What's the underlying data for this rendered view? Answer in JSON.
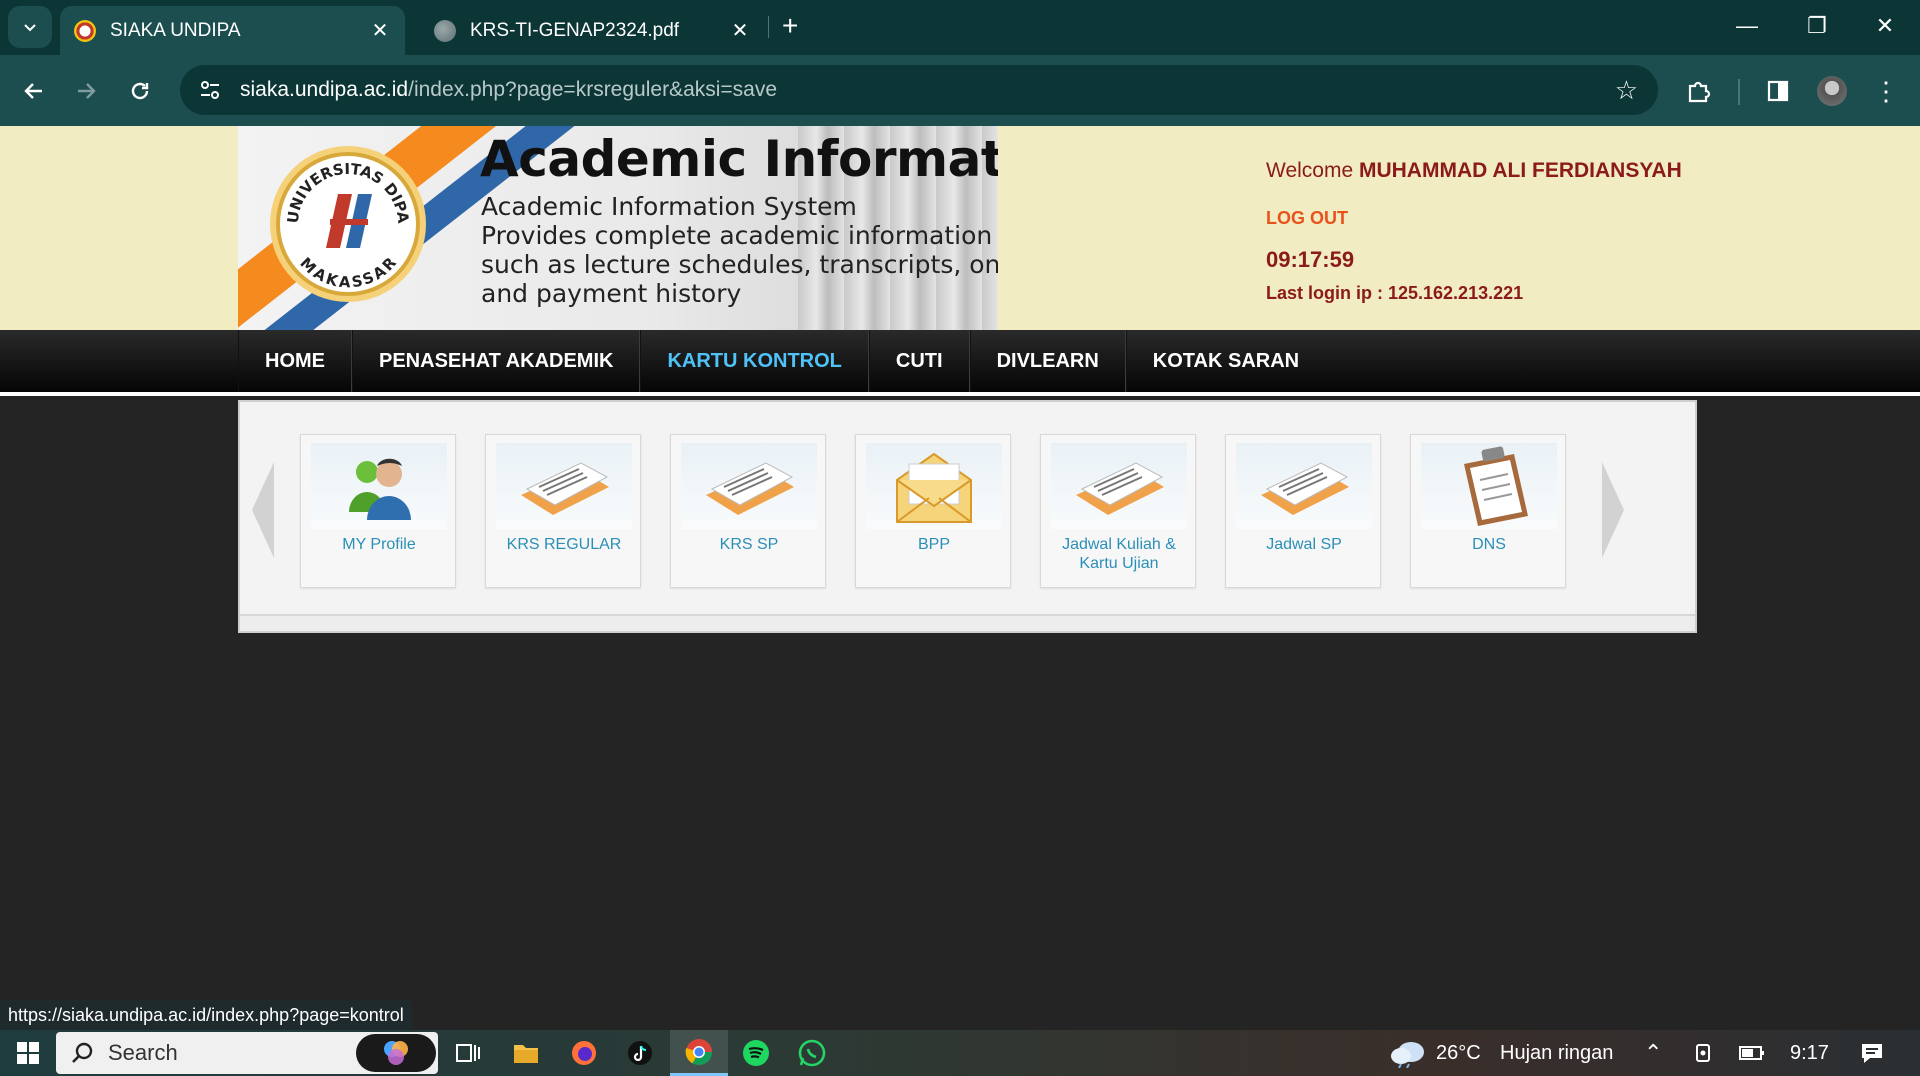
{
  "browser": {
    "tabs": [
      {
        "title": "SIAKA UNDIPA",
        "active": true
      },
      {
        "title": "KRS-TI-GENAP2324.pdf",
        "active": false
      }
    ],
    "url_domain": "siaka.undipa.ac.id",
    "url_path": "/index.php?page=krsreguler&aksi=save",
    "status_url": "https://siaka.undipa.ac.id/index.php?page=kontrol"
  },
  "header": {
    "title": "Academic Information System",
    "desc": [
      "Academic Information System",
      "Provides complete academic information",
      "such as lecture schedules, transcripts, online KRS,",
      "and payment history"
    ],
    "logo_top": "UNIVERSITAS DIPA",
    "logo_bottom": "MAKASSAR",
    "welcome_label": "Welcome",
    "user_name": "MUHAMMAD ALI FERDIANSYAH",
    "logout": "LOG OUT",
    "clock": "09:17:59",
    "last_login": "Last login ip : 125.162.213.221"
  },
  "menu": [
    {
      "label": "HOME",
      "selected": false
    },
    {
      "label": "PENASEHAT AKADEMIK",
      "selected": false
    },
    {
      "label": "KARTU KONTROL",
      "selected": true
    },
    {
      "label": "CUTI",
      "selected": false
    },
    {
      "label": "DIVLEARN",
      "selected": false
    },
    {
      "label": "KOTAK SARAN",
      "selected": false
    }
  ],
  "tiles": [
    {
      "label": "MY Profile",
      "icon": "users-icon"
    },
    {
      "label": "KRS REGULAR",
      "icon": "documents-icon"
    },
    {
      "label": "KRS SP",
      "icon": "documents-icon"
    },
    {
      "label": "BPP",
      "icon": "envelope-icon"
    },
    {
      "label": "Jadwal Kuliah & Kartu Ujian",
      "icon": "documents-icon"
    },
    {
      "label": "Jadwal SP",
      "icon": "documents-icon"
    },
    {
      "label": "DNS",
      "icon": "clipboard-icon"
    }
  ],
  "taskbar": {
    "search_label": "Search",
    "weather_temp": "26°C",
    "weather_desc": "Hujan ringan",
    "time": "9:17"
  },
  "colors": {
    "header_bg": "#f2ecc2",
    "user_red": "#8b1a1a",
    "logout_orange": "#e8531c",
    "menu_selected": "#4fc3f7",
    "tile_label": "#2b8fb8"
  }
}
